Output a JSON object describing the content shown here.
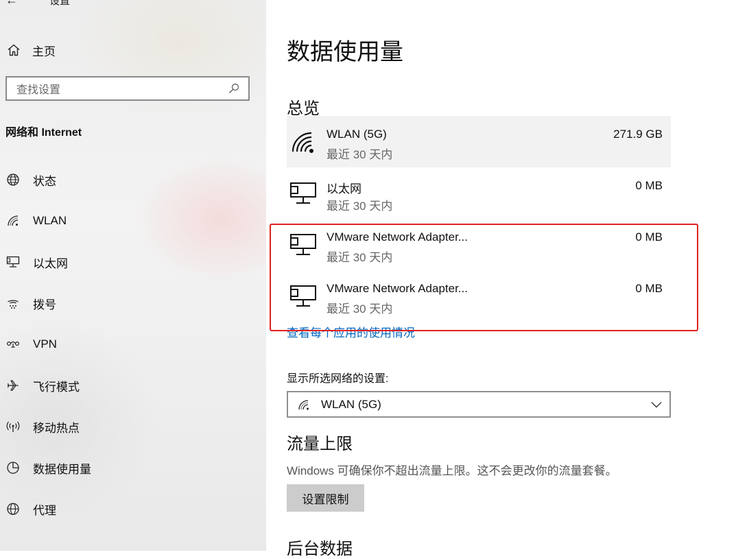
{
  "window": {
    "title": "设置"
  },
  "sidebar": {
    "home_label": "主页",
    "search_placeholder": "查找设置",
    "section_heading": "网络和 Internet",
    "items": [
      {
        "label": "状态",
        "icon": "globe-status-icon"
      },
      {
        "label": "WLAN",
        "icon": "wifi-icon"
      },
      {
        "label": "以太网",
        "icon": "ethernet-icon"
      },
      {
        "label": "拨号",
        "icon": "dialup-icon"
      },
      {
        "label": "VPN",
        "icon": "vpn-icon"
      },
      {
        "label": "飞行模式",
        "icon": "airplane-icon"
      },
      {
        "label": "移动热点",
        "icon": "hotspot-icon"
      },
      {
        "label": "数据使用量",
        "icon": "data-usage-icon"
      },
      {
        "label": "代理",
        "icon": "proxy-globe-icon"
      }
    ]
  },
  "main": {
    "title": "数据使用量",
    "overview_heading": "总览",
    "usage": [
      {
        "name": "WLAN (5G)",
        "period": "最近 30 天内",
        "amount": "271.9 GB",
        "icon": "wifi-icon"
      },
      {
        "name": "以太网",
        "period": "最近 30 天内",
        "amount": "0 MB",
        "icon": "ethernet-icon"
      },
      {
        "name": "VMware Network Adapter...",
        "period": "最近 30 天内",
        "amount": "0 MB",
        "icon": "ethernet-icon"
      },
      {
        "name": "VMware Network Adapter...",
        "period": "最近 30 天内",
        "amount": "0 MB",
        "icon": "ethernet-icon"
      }
    ],
    "per_app_link": "查看每个应用的使用情况",
    "network_select_label": "显示所选网络的设置:",
    "network_select_value": "WLAN (5G)",
    "limit_heading": "流量上限",
    "limit_description": "Windows 可确保你不超出流量上限。这不会更改你的流量套餐。",
    "limit_button": "设置限制",
    "background_heading": "后台数据"
  },
  "colors": {
    "accent_link": "#0067c0",
    "annotation_box": "#e02020",
    "selected_row": "#f2f2f2",
    "button_bg": "#cccccc"
  }
}
